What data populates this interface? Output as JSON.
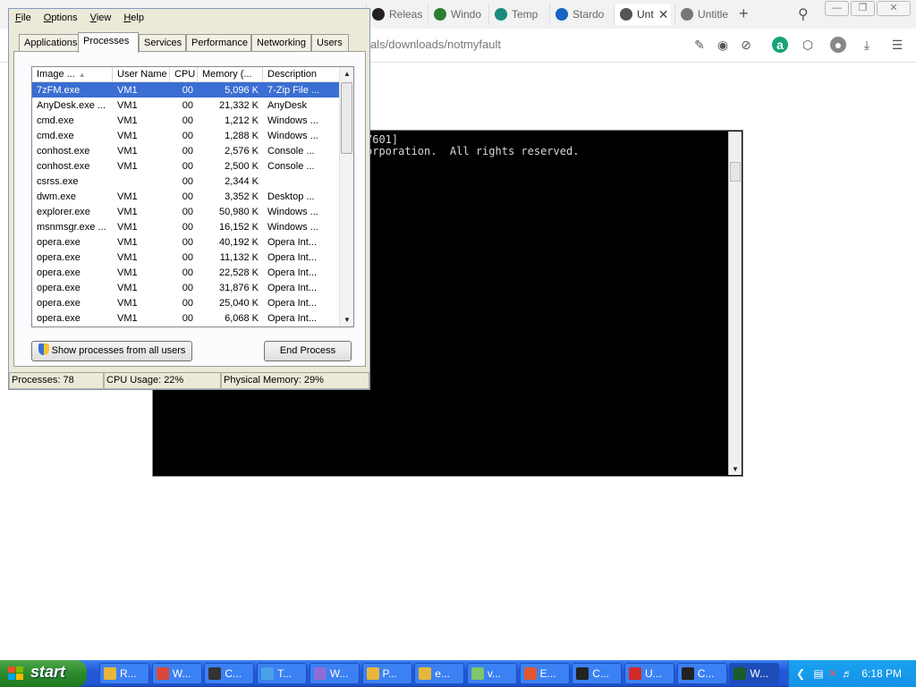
{
  "browser": {
    "tabs": [
      {
        "label": "Releas",
        "color": "#222222",
        "active": false
      },
      {
        "label": "Windo",
        "color": "#2e7d32",
        "active": false
      },
      {
        "label": "Temp",
        "color": "#1a8a7a",
        "active": false
      },
      {
        "label": "Stardo",
        "color": "#1565c0",
        "active": false
      },
      {
        "label": "Unt",
        "color": "#555555",
        "active": true
      },
      {
        "label": "Untitle",
        "color": "#777777",
        "active": false
      }
    ],
    "url": "als/downloads/notmyfault",
    "toolbar_icons": [
      "edit-icon",
      "camera-icon",
      "block-icon",
      "a-icon",
      "box-icon",
      "profile-icon",
      "download-icon",
      "settings-icon"
    ]
  },
  "console": {
    "lines": [
      "7601]",
      "orporation.  All rights reserved."
    ]
  },
  "taskmanager": {
    "menu": [
      {
        "first": "F",
        "rest": "ile"
      },
      {
        "first": "O",
        "rest": "ptions"
      },
      {
        "first": "V",
        "rest": "iew"
      },
      {
        "first": "H",
        "rest": "elp"
      }
    ],
    "tabs": [
      "Applications",
      "Processes",
      "Services",
      "Performance",
      "Networking",
      "Users"
    ],
    "active_tab": "Processes",
    "columns": [
      "Image ...",
      "User Name",
      "CPU",
      "Memory (...",
      "Description"
    ],
    "rows": [
      {
        "image": "7zFM.exe",
        "user": "VM1",
        "cpu": "00",
        "mem": "5,096 K",
        "desc": "7-Zip File ...",
        "selected": true
      },
      {
        "image": "AnyDesk.exe ...",
        "user": "VM1",
        "cpu": "00",
        "mem": "21,332 K",
        "desc": "AnyDesk",
        "selected": false
      },
      {
        "image": "cmd.exe",
        "user": "VM1",
        "cpu": "00",
        "mem": "1,212 K",
        "desc": "Windows ...",
        "selected": false
      },
      {
        "image": "cmd.exe",
        "user": "VM1",
        "cpu": "00",
        "mem": "1,288 K",
        "desc": "Windows ...",
        "selected": false
      },
      {
        "image": "conhost.exe",
        "user": "VM1",
        "cpu": "00",
        "mem": "2,576 K",
        "desc": "Console ...",
        "selected": false
      },
      {
        "image": "conhost.exe",
        "user": "VM1",
        "cpu": "00",
        "mem": "2,500 K",
        "desc": "Console ...",
        "selected": false
      },
      {
        "image": "csrss.exe",
        "user": "",
        "cpu": "00",
        "mem": "2,344 K",
        "desc": "",
        "selected": false
      },
      {
        "image": "dwm.exe",
        "user": "VM1",
        "cpu": "00",
        "mem": "3,352 K",
        "desc": "Desktop ...",
        "selected": false
      },
      {
        "image": "explorer.exe",
        "user": "VM1",
        "cpu": "00",
        "mem": "50,980 K",
        "desc": "Windows ...",
        "selected": false
      },
      {
        "image": "msnmsgr.exe ...",
        "user": "VM1",
        "cpu": "00",
        "mem": "16,152 K",
        "desc": "Windows ...",
        "selected": false
      },
      {
        "image": "opera.exe",
        "user": "VM1",
        "cpu": "00",
        "mem": "40,192 K",
        "desc": "Opera Int...",
        "selected": false
      },
      {
        "image": "opera.exe",
        "user": "VM1",
        "cpu": "00",
        "mem": "11,132 K",
        "desc": "Opera Int...",
        "selected": false
      },
      {
        "image": "opera.exe",
        "user": "VM1",
        "cpu": "00",
        "mem": "22,528 K",
        "desc": "Opera Int...",
        "selected": false
      },
      {
        "image": "opera.exe",
        "user": "VM1",
        "cpu": "00",
        "mem": "31,876 K",
        "desc": "Opera Int...",
        "selected": false
      },
      {
        "image": "opera.exe",
        "user": "VM1",
        "cpu": "00",
        "mem": "25,040 K",
        "desc": "Opera Int...",
        "selected": false
      },
      {
        "image": "opera.exe",
        "user": "VM1",
        "cpu": "00",
        "mem": "6,068 K",
        "desc": "Opera Int...",
        "selected": false
      }
    ],
    "show_all_label": "Show processes from all users",
    "end_process_label": "End Process",
    "status": {
      "processes": "Processes: 78",
      "cpu": "CPU Usage: 22%",
      "memory": "Physical Memory: 29%"
    }
  },
  "taskbar": {
    "start_label": "start",
    "items": [
      {
        "label": "R...",
        "color": "#e8b63a"
      },
      {
        "label": "W...",
        "color": "#d9483b"
      },
      {
        "label": "C...",
        "color": "#333333"
      },
      {
        "label": "T...",
        "color": "#4aa3e8"
      },
      {
        "label": "W...",
        "color": "#8e6ed6"
      },
      {
        "label": "P...",
        "color": "#e8b63a"
      },
      {
        "label": "e...",
        "color": "#e8b63a"
      },
      {
        "label": "v...",
        "color": "#7cc86a"
      },
      {
        "label": "E...",
        "color": "#e0572f"
      },
      {
        "label": "C...",
        "color": "#222222"
      },
      {
        "label": "U...",
        "color": "#d22a2a"
      },
      {
        "label": "C...",
        "color": "#222222"
      },
      {
        "label": "W...",
        "color": "#1a5c2a"
      }
    ],
    "clock": "6:18 PM"
  }
}
